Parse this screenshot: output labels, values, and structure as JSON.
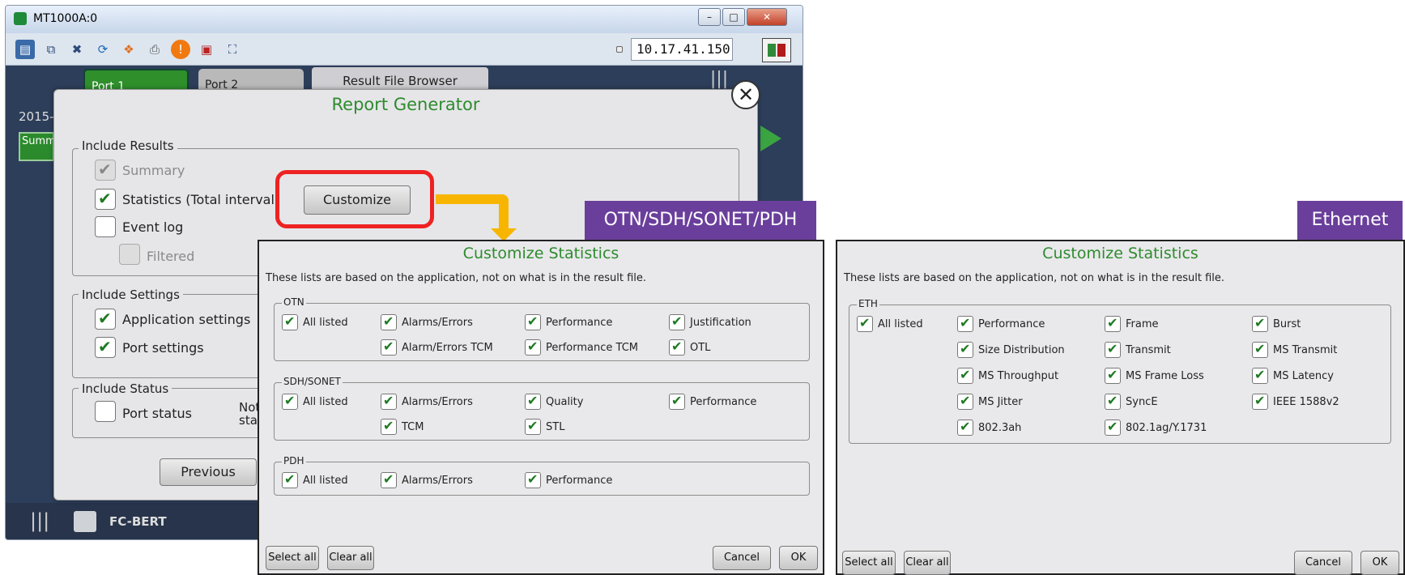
{
  "window": {
    "title": "MT1000A:0",
    "ip_address": "10.17.41.150",
    "controls": {
      "minimize": "–",
      "maximize": "□",
      "close": "✕"
    }
  },
  "toolbar_icons": [
    "monitor-icon",
    "windows-icon",
    "tools-icon",
    "refresh-icon",
    "windows-logo-icon",
    "printer-icon",
    "alert-icon",
    "network-icon",
    "fullscreen-icon"
  ],
  "tabs": {
    "port1": "Port 1",
    "port2": "Port 2",
    "result_file_browser": "Result File Browser"
  },
  "background": {
    "date_fragment": "2015-",
    "summary_fragment": "Summ",
    "app_name": "FC-BERT"
  },
  "report_generator": {
    "title": "Report Generator",
    "include_results": {
      "label": "Include Results",
      "summary": "Summary",
      "statistics": "Statistics (Total interval)",
      "event_log": "Event log",
      "filtered": "Filtered",
      "customize_button": "Customize"
    },
    "include_settings": {
      "label": "Include Settings",
      "application_settings": "Application settings",
      "port_settings": "Port settings"
    },
    "include_status": {
      "label": "Include Status",
      "port_status": "Port status",
      "fragment_line1": "Not",
      "fragment_line2": "sta"
    },
    "previous_button": "Previous"
  },
  "tags": {
    "otn": "OTN/SDH/SONET/PDH",
    "ethernet": "Ethernet"
  },
  "otn_panel": {
    "title": "Customize Statistics",
    "note": "These lists are based on the application, not on what is in the result file.",
    "sections": {
      "otn": {
        "label": "OTN",
        "items": [
          "All listed",
          "Alarms/Errors",
          "Performance",
          "Justification",
          "Alarm/Errors TCM",
          "Performance TCM",
          "OTL"
        ]
      },
      "sdh": {
        "label": "SDH/SONET",
        "items": [
          "All listed",
          "Alarms/Errors",
          "Quality",
          "Performance",
          "TCM",
          "STL"
        ]
      },
      "pdh": {
        "label": "PDH",
        "items": [
          "All listed",
          "Alarms/Errors",
          "Performance"
        ]
      }
    },
    "buttons": {
      "select_all": "Select all",
      "clear_all": "Clear all",
      "cancel": "Cancel",
      "ok": "OK"
    }
  },
  "eth_panel": {
    "title": "Customize Statistics",
    "note": "These lists are based on the application, not on what is in the result file.",
    "section": {
      "label": "ETH",
      "items": [
        "All listed",
        "Performance",
        "Frame",
        "Burst",
        "Size Distribution",
        "Transmit",
        "MS Transmit",
        "MS Throughput",
        "MS Frame Loss",
        "MS Latency",
        "MS Jitter",
        "SyncE",
        "IEEE 1588v2",
        "802.3ah",
        "802.1ag/Y.1731"
      ]
    },
    "buttons": {
      "select_all": "Select all",
      "clear_all": "Clear all",
      "cancel": "Cancel",
      "ok": "OK"
    }
  },
  "colors": {
    "accent_green": "#2e8b2e",
    "tag_purple": "#6a3f9c",
    "highlight_red": "#e22222",
    "arrow_orange": "#f7b500"
  }
}
